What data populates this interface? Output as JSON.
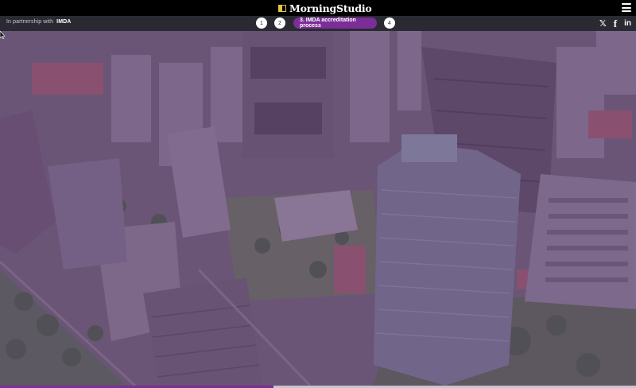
{
  "brand": {
    "name": "MorningStudio"
  },
  "partner": {
    "prefix": "In partnership with",
    "name": "IMDA"
  },
  "steps": [
    {
      "label": "1",
      "active": false
    },
    {
      "label": "2",
      "active": false
    },
    {
      "label": "3. IMDA accreditation process",
      "active": true
    },
    {
      "label": "4",
      "active": false
    }
  ],
  "social": {
    "x": "𝕏",
    "facebook": "f",
    "linkedin": "in"
  },
  "hero": {
    "description_icon": "city-aerial-photo"
  },
  "progress": {
    "fraction": 0.43
  },
  "colors": {
    "accent": "#7b2e97",
    "topbar": "#000000",
    "subbar": "#2b2a33"
  }
}
